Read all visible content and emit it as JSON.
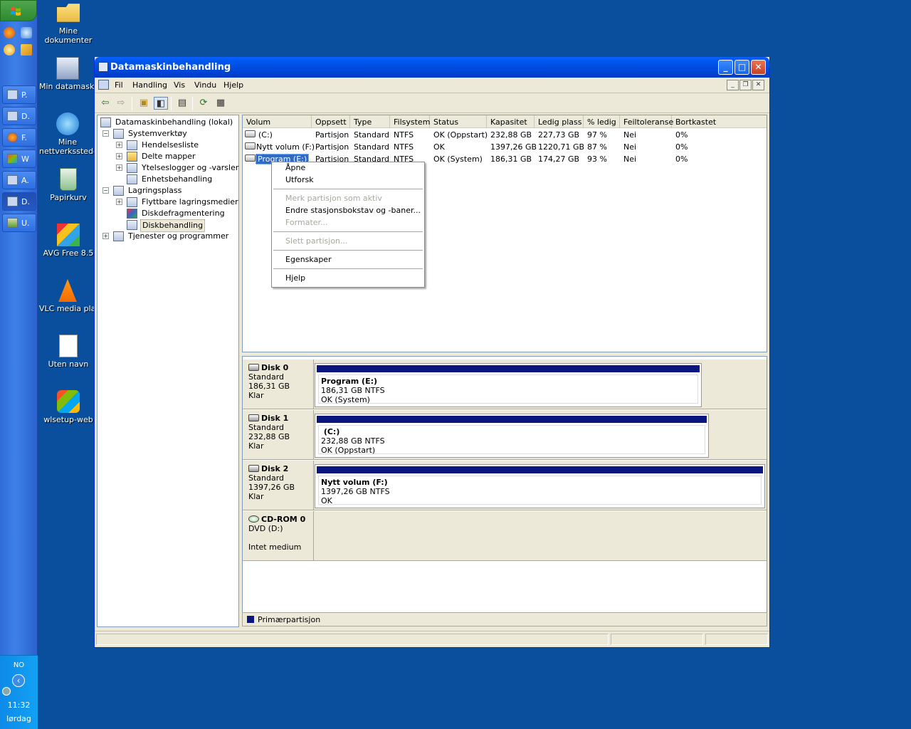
{
  "taskbar": {
    "buttons": [
      {
        "label": "P."
      },
      {
        "label": "D."
      },
      {
        "label": "F."
      },
      {
        "label": "W"
      },
      {
        "label": "A."
      },
      {
        "label": "D."
      },
      {
        "label": "U."
      }
    ],
    "tray": {
      "lang": "NO",
      "time": "11:32",
      "day": "lørdag"
    }
  },
  "desktop": {
    "icons": [
      {
        "label": "Mine dokumenter"
      },
      {
        "label": "Min datamaskin"
      },
      {
        "label": "Mine nettverkssteder"
      },
      {
        "label": "Papirkurv"
      },
      {
        "label": "AVG Free 8.5"
      },
      {
        "label": "VLC media player"
      },
      {
        "label": "Uten navn"
      },
      {
        "label": "wlsetup-web"
      }
    ]
  },
  "window": {
    "title": "Datamaskinbehandling",
    "menu": [
      "Fil",
      "Handling",
      "Vis",
      "Vindu",
      "Hjelp"
    ]
  },
  "tree": {
    "root": "Datamaskinbehandling (lokal)",
    "items": [
      "Systemverktøy",
      "Hendelsesliste",
      "Delte mapper",
      "Ytelseslogger og -varsler",
      "Enhetsbehandling",
      "Lagringsplass",
      "Flyttbare lagringsmedier",
      "Diskdefragmentering",
      "Diskbehandling",
      "Tjenester og programmer"
    ]
  },
  "volumes": {
    "columns": [
      "Volum",
      "Oppsett",
      "Type",
      "Filsystem",
      "Status",
      "Kapasitet",
      "Ledig plass",
      "% ledig",
      "Feiltoleranse",
      "Bortkastet"
    ],
    "rows": [
      [
        "(C:)",
        "Partisjon",
        "Standard",
        "NTFS",
        "OK (Oppstart)",
        "232,88 GB",
        "227,73 GB",
        "97 %",
        "Nei",
        "0%"
      ],
      [
        "Nytt volum (F:)",
        "Partisjon",
        "Standard",
        "NTFS",
        "OK",
        "1397,26 GB",
        "1220,71 GB",
        "87 %",
        "Nei",
        "0%"
      ],
      [
        "Program (E:)",
        "Partisjon",
        "Standard",
        "NTFS",
        "OK (System)",
        "186,31 GB",
        "174,27 GB",
        "93 %",
        "Nei",
        "0%"
      ]
    ]
  },
  "disks": [
    {
      "name": "Disk 0",
      "type": "Standard",
      "size": "186,31 GB",
      "state": "Klar",
      "part_name": "Program  (E:)",
      "part_size": "186,31 GB NTFS",
      "part_status": "OK (System)"
    },
    {
      "name": "Disk 1",
      "type": "Standard",
      "size": "232,88 GB",
      "state": "Klar",
      "part_name": " (C:)",
      "part_size": "232,88 GB NTFS",
      "part_status": "OK (Oppstart)"
    },
    {
      "name": "Disk 2",
      "type": "Standard",
      "size": "1397,26 GB",
      "state": "Klar",
      "part_name": "Nytt volum  (F:)",
      "part_size": "1397,26 GB NTFS",
      "part_status": "OK"
    },
    {
      "name": "CD-ROM 0",
      "type": "DVD (D:)",
      "size": "",
      "state": "Intet medium"
    }
  ],
  "legend": "Primærpartisjon",
  "context_menu": {
    "items": [
      {
        "label": "Åpne",
        "disabled": false
      },
      {
        "label": "Utforsk",
        "disabled": false
      },
      {
        "label": "Merk partisjon som aktiv",
        "disabled": true
      },
      {
        "label": "Endre stasjonsbokstav og -baner...",
        "disabled": false
      },
      {
        "label": "Formater...",
        "disabled": true
      },
      {
        "label": "Slett partisjon...",
        "disabled": true
      },
      {
        "label": "Egenskaper",
        "disabled": false
      },
      {
        "label": "Hjelp",
        "disabled": false
      }
    ]
  },
  "colors": {
    "primary_partition": "#0a167d",
    "titlebar": "#0058ee"
  }
}
